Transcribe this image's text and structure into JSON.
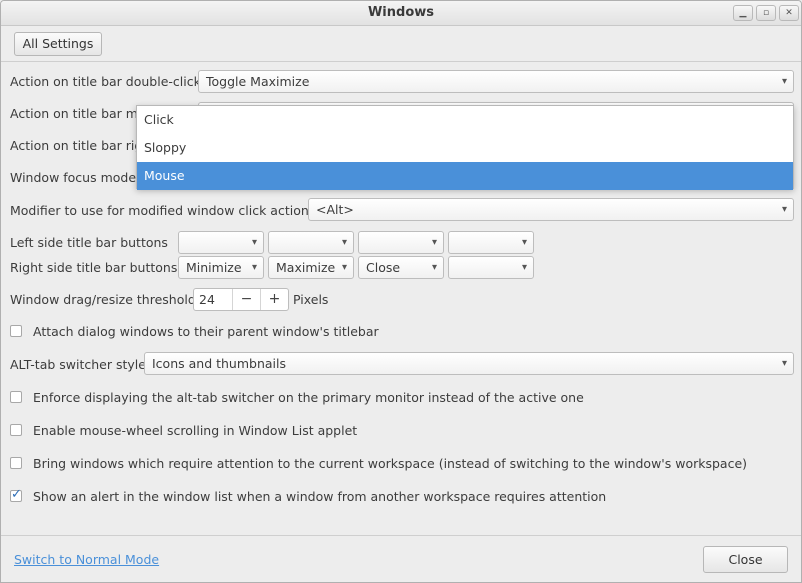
{
  "window": {
    "title": "Windows",
    "controls": [
      "minimize-icon",
      "maximize-icon",
      "close-icon"
    ]
  },
  "toolbar": {
    "all_settings_label": "All Settings"
  },
  "settings": {
    "double_click": {
      "label": "Action on title bar double-click",
      "value": "Toggle Maximize"
    },
    "middle_click": {
      "label": "Action on title bar middle-click"
    },
    "right_click": {
      "label": "Action on title bar right-click"
    },
    "focus_mode": {
      "label": "Window focus mode"
    },
    "modifier": {
      "label": "Modifier to use for modified window click actions",
      "value": "<Alt>"
    },
    "left_buttons": {
      "label": "Left side title bar buttons",
      "values": [
        "",
        "",
        "",
        ""
      ]
    },
    "right_buttons": {
      "label": "Right side title bar buttons",
      "values": [
        "Minimize",
        "Maximize",
        "Close",
        ""
      ]
    },
    "drag_threshold": {
      "label": "Window drag/resize threshold",
      "value": "24",
      "unit": "Pixels",
      "minus": "−",
      "plus": "+"
    },
    "attach_dialogs": {
      "label": "Attach dialog windows to their parent window's titlebar",
      "checked": false
    },
    "alttab": {
      "label": "ALT-tab switcher style",
      "value": "Icons and thumbnails"
    },
    "alttab_primary": {
      "label": "Enforce displaying the alt-tab switcher on the primary monitor instead of the active one",
      "checked": false
    },
    "mousewheel": {
      "label": "Enable mouse-wheel scrolling in Window List applet",
      "checked": false
    },
    "bring_windows": {
      "label": "Bring windows which require attention to the current workspace (instead of switching to the window's workspace)",
      "checked": false
    },
    "show_alert": {
      "label": "Show an alert in the window list when a window from another workspace requires attention",
      "checked": true
    }
  },
  "focus_dropdown": {
    "options": [
      "Click",
      "Sloppy",
      "Mouse"
    ],
    "selected": "Mouse"
  },
  "footer": {
    "switch_mode_label": "Switch to Normal Mode",
    "close_label": "Close"
  },
  "colors": {
    "accent": "#4a90d9",
    "background": "#ededed"
  }
}
